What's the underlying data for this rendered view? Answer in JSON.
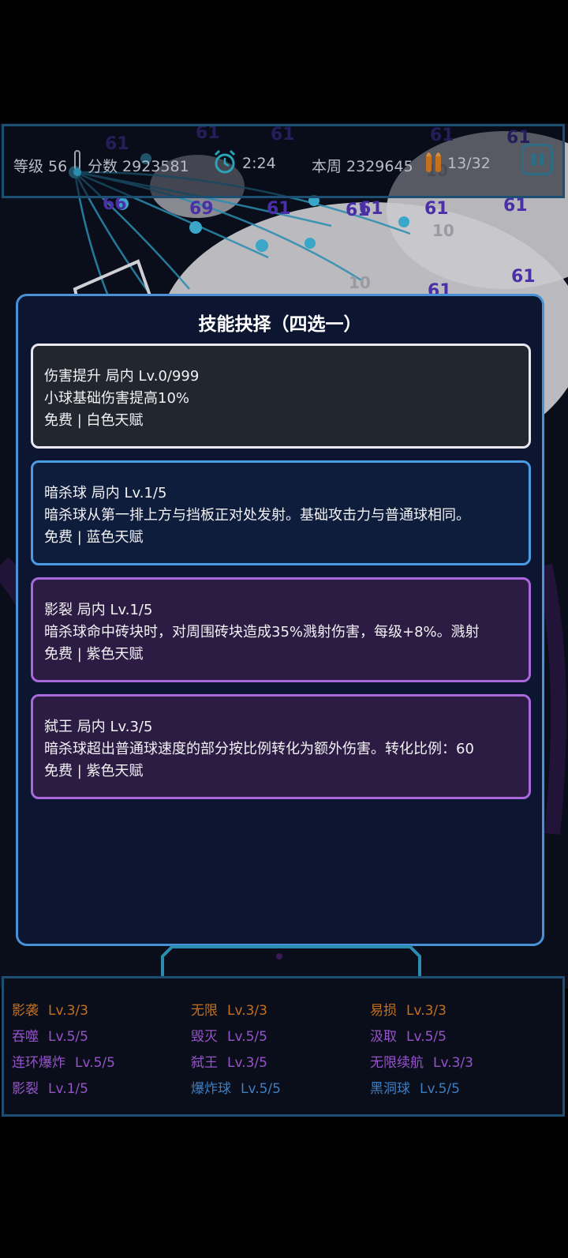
{
  "hud": {
    "level": "等级 56",
    "score": "分数 2923581",
    "timer": "2:24",
    "weekly": "本周 2329645",
    "ammo": "13/32"
  },
  "background_numbers": [
    "61",
    "61",
    "61",
    "61",
    "61",
    "61",
    "66",
    "69",
    "61",
    "61",
    "61",
    "61",
    "61",
    "61",
    "10",
    "10",
    "10"
  ],
  "dialog": {
    "title": "技能抉择（四选一）",
    "cards": [
      {
        "rarity": "white",
        "name_line": "伤害提升  局内 Lv.0/999",
        "description": "小球基础伤害提高10%",
        "footer": "免费  |  白色天赋"
      },
      {
        "rarity": "blue",
        "name_line": "暗杀球  局内 Lv.1/5",
        "description": "暗杀球从第一排上方与挡板正对处发射。基础攻击力与普通球相同。",
        "footer": "免费  |  蓝色天赋"
      },
      {
        "rarity": "purple",
        "name_line": "影裂  局内 Lv.1/5",
        "description": "暗杀球命中砖块时，对周围砖块造成35%溅射伤害，每级+8%。溅射",
        "footer": "免费  |  紫色天赋"
      },
      {
        "rarity": "purple",
        "name_line": "弑王  局内 Lv.3/5",
        "description": "暗杀球超出普通球速度的部分按比例转化为额外伤害。转化比例：60",
        "footer": "免费  |  紫色天赋"
      }
    ]
  },
  "owned_skills": [
    {
      "name": "影袭",
      "level": "Lv.3/3",
      "color": "#c4701f"
    },
    {
      "name": "无限",
      "level": "Lv.3/3",
      "color": "#c4701f"
    },
    {
      "name": "易损",
      "level": "Lv.3/3",
      "color": "#c4701f"
    },
    {
      "name": "吞噬",
      "level": "Lv.5/5",
      "color": "#9654c9"
    },
    {
      "name": "毁灭",
      "level": "Lv.5/5",
      "color": "#9654c9"
    },
    {
      "name": "汲取",
      "level": "Lv.5/5",
      "color": "#9654c9"
    },
    {
      "name": "连环爆炸",
      "level": "Lv.5/5",
      "color": "#9654c9"
    },
    {
      "name": "弑王",
      "level": "Lv.3/5",
      "color": "#9654c9"
    },
    {
      "name": "无限续航",
      "level": "Lv.3/3",
      "color": "#9654c9"
    },
    {
      "name": "影裂",
      "level": "Lv.1/5",
      "color": "#9654c9"
    },
    {
      "name": "爆炸球",
      "level": "Lv.5/5",
      "color": "#3f7fc1"
    },
    {
      "name": "黑洞球",
      "level": "Lv.5/5",
      "color": "#3f7fc1"
    }
  ],
  "colors": {
    "hud_border": "#1d4f72",
    "dialog_border": "#4a90d6",
    "white_rarity": "#e8e8ee",
    "blue_rarity": "#4a9ae4",
    "purple_rarity": "#a968db"
  }
}
